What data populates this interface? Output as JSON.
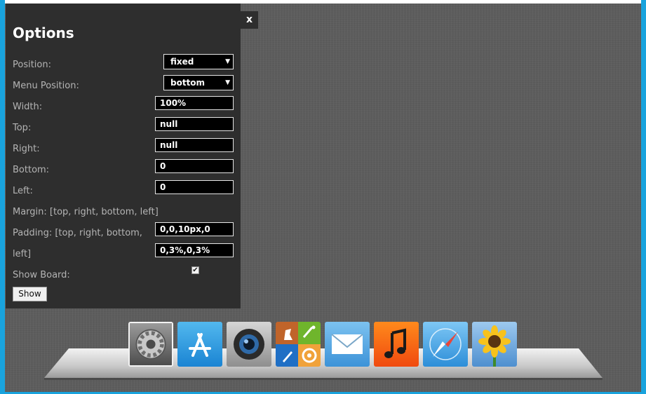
{
  "options": {
    "title": "Options",
    "close_label": "x",
    "position": {
      "label": "Position:",
      "value": "fixed"
    },
    "menu_position": {
      "label": "Menu Position:",
      "value": "bottom"
    },
    "width": {
      "label": "Width:",
      "value": "100%"
    },
    "top": {
      "label": "Top:",
      "value": "null"
    },
    "right": {
      "label": "Right:",
      "value": "null"
    },
    "bottom": {
      "label": "Bottom:",
      "value": "0"
    },
    "left": {
      "label": "Left:",
      "value": "0"
    },
    "margin": {
      "label": "Margin: [top, right, bottom, left]"
    },
    "padding": {
      "label_line1": "Padding: [top, right, bottom,",
      "label_line2": "left]",
      "value_margin": "0,0,10px,0",
      "value_padding": "0,3%,0,3%"
    },
    "show_board": {
      "label": "Show Board:",
      "checked": true
    },
    "show_button": "Show"
  },
  "dock": {
    "items": [
      {
        "name": "system-preferences-icon",
        "active": true
      },
      {
        "name": "app-store-icon",
        "active": false
      },
      {
        "name": "camera-icon",
        "active": false
      },
      {
        "name": "game-center-icon",
        "active": false
      },
      {
        "name": "mail-icon",
        "active": false
      },
      {
        "name": "music-icon",
        "active": false
      },
      {
        "name": "safari-icon",
        "active": false
      },
      {
        "name": "photo-sunflower-icon",
        "active": false
      }
    ]
  },
  "colors": {
    "panel_bg": "#2e2e2e",
    "desktop_bg": "#5d5d5d",
    "window_border": "#19a3dd"
  }
}
